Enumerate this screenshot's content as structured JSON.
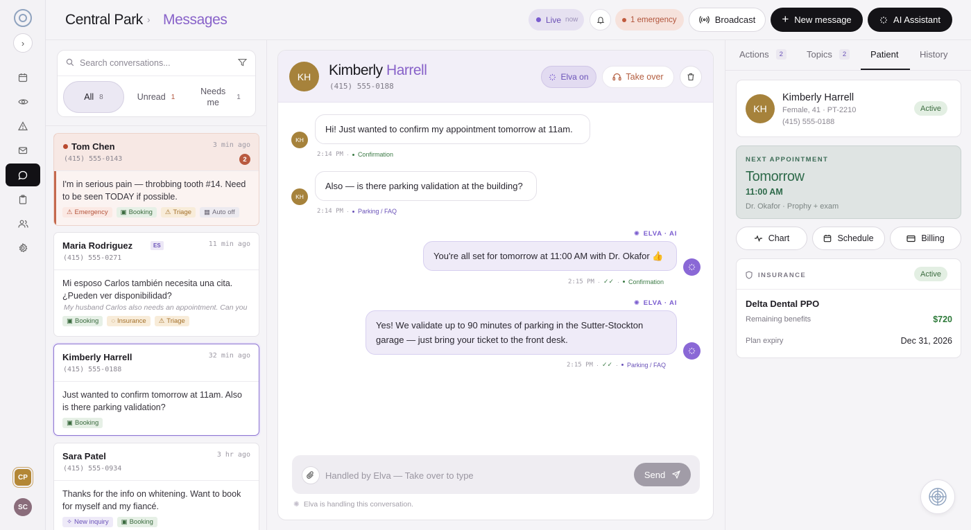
{
  "header": {
    "location": "Central Park",
    "page": "Messages",
    "live_label": "Live",
    "live_time": "now",
    "emergency_label": "1 emergency",
    "broadcast_label": "Broadcast",
    "new_message_label": "New message",
    "ai_assistant_label": "AI Assistant"
  },
  "rail": {
    "user_initials_1": "CP",
    "user_initials_2": "SC"
  },
  "search": {
    "placeholder": "Search conversations..."
  },
  "filters": {
    "all_label": "All",
    "all_count": "8",
    "unread_label": "Unread",
    "unread_count": "1",
    "needs_me_label": "Needs me",
    "needs_me_count": "1"
  },
  "conversations": [
    {
      "name": "Tom Chen",
      "phone": "(415) 555-0143",
      "time": "3 min ago",
      "unread": "2",
      "preview": "I'm in serious pain — throbbing tooth #14. Need to be seen TODAY if possible.",
      "tags": [
        "Emergency",
        "Booking",
        "Triage",
        "Auto off"
      ]
    },
    {
      "name": "Maria Rodriguez",
      "lang": "ES",
      "phone": "(415) 555-0271",
      "time": "11 min ago",
      "preview": "Mi esposo Carlos también necesita una cita. ¿Pueden ver disponibilidad?",
      "translation": "My husband Carlos also needs an appointment. Can you",
      "tags": [
        "Booking",
        "Insurance",
        "Triage"
      ]
    },
    {
      "name": "Kimberly Harrell",
      "phone": "(415) 555-0188",
      "time": "32 min ago",
      "preview": "Just wanted to confirm tomorrow at 11am. Also is there parking validation?",
      "tags": [
        "Booking"
      ]
    },
    {
      "name": "Sara Patel",
      "phone": "(415) 555-0934",
      "time": "3 hr ago",
      "preview": "Thanks for the info on whitening. Want to book for myself and my fiancé.",
      "tags": [
        "New inquiry",
        "Booking"
      ]
    }
  ],
  "chat": {
    "initials": "KH",
    "first_name": "Kimberly",
    "last_name": "Harrell",
    "phone": "(415) 555-0188",
    "elva_label": "Elva on",
    "take_over_label": "Take over",
    "messages": [
      {
        "text": "Hi! Just wanted to confirm my appointment tomorrow at 11am.",
        "time": "2:14 PM",
        "tag": "Confirmation"
      },
      {
        "text": "Also — is there parking validation at the building?",
        "time": "2:14 PM",
        "tag": "Parking / FAQ"
      },
      {
        "sender": "ELVA · AI",
        "text": "You're all set for tomorrow at 11:00 AM with Dr. Okafor 👍",
        "time": "2:15 PM",
        "tag": "Confirmation"
      },
      {
        "sender": "ELVA · AI",
        "text": "Yes! We validate up to 90 minutes of parking in the Sutter-Stockton garage — just bring your ticket to the front desk.",
        "time": "2:15 PM",
        "tag": "Parking / FAQ"
      }
    ],
    "composer_placeholder": "Handled by Elva — Take over to type",
    "send_label": "Send",
    "handling_note": "Elva is handling this conversation."
  },
  "right": {
    "tabs": [
      {
        "label": "Actions",
        "count": "2"
      },
      {
        "label": "Topics",
        "count": "2"
      },
      {
        "label": "Patient"
      },
      {
        "label": "History"
      }
    ],
    "patient": {
      "initials": "KH",
      "name": "Kimberly Harrell",
      "details": "Female, 41 · PT-2210",
      "phone": "(415) 555-0188",
      "status": "Active"
    },
    "appointment": {
      "label": "NEXT APPOINTMENT",
      "day": "Tomorrow",
      "time": "11:00 AM",
      "details": "Dr. Okafor · Prophy + exam"
    },
    "actions": [
      "Chart",
      "Schedule",
      "Billing"
    ],
    "insurance": {
      "label": "INSURANCE",
      "status": "Active",
      "plan": "Delta Dental PPO",
      "remaining_label": "Remaining benefits",
      "remaining_value": "$720",
      "expiry_label": "Plan expiry",
      "expiry_value": "Dec 31, 2026"
    }
  },
  "colors": {
    "accent": "#8862c9",
    "emergency": "#b8492f",
    "success": "#3b6b3f"
  }
}
